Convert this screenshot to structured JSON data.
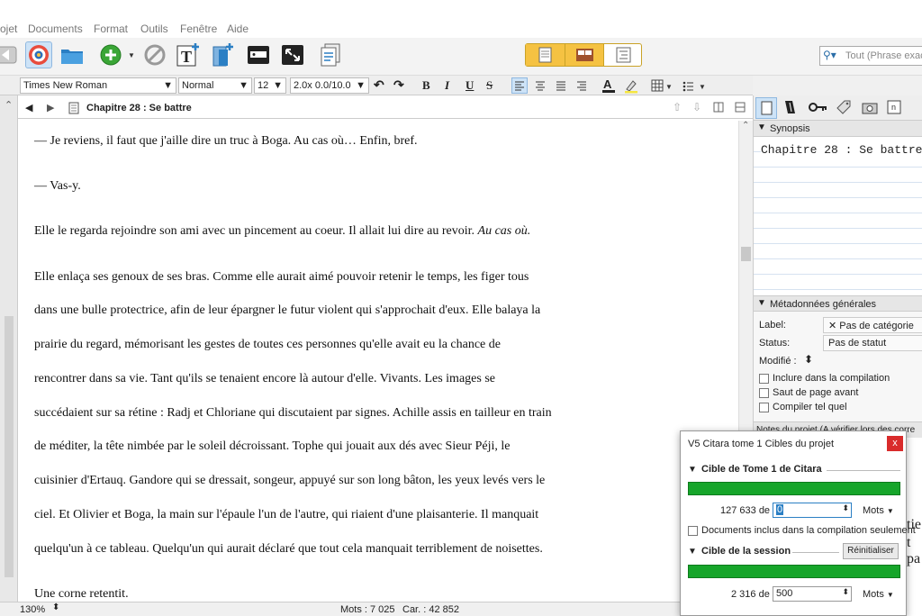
{
  "menu": [
    "ojet",
    "Documents",
    "Format",
    "Outils",
    "Fenêtre",
    "Aide"
  ],
  "search": {
    "placeholder": "Tout (Phrase exact"
  },
  "format": {
    "font": "Times New Roman",
    "style": "Normal",
    "size": "12",
    "spacing": "2.0x 0.0/10.0",
    "bold": "B",
    "italic": "I",
    "underline": "U",
    "strike": "S"
  },
  "editor": {
    "title": "Chapitre 28 : Se battre",
    "paragraphs": [
      "— Je reviens, il faut que j'aille dire un truc à Boga. Au cas où… Enfin, bref.",
      "— Vas-y.",
      "Elle le regarda rejoindre son ami avec un pincement au coeur. Il allait lui dire au revoir.",
      "Au cas où.",
      "Elle enlaça ses genoux de ses bras. Comme elle aurait aimé pouvoir retenir le temps, les figer tous",
      "dans une bulle protectrice, afin de leur épargner le futur violent qui s'approchait d'eux. Elle balaya la",
      "prairie du regard, mémorisant les gestes de toutes ces personnes qu'elle avait eu la chance de",
      "rencontrer dans sa vie. Tant qu'ils se tenaient encore là autour d'elle. Vivants. Les images se",
      "succédaient sur sa rétine :  Radj et Chloriane qui discutaient par signes. Achille assis en tailleur en train",
      "de méditer, la tête nimbée par le soleil décroissant. Tophe qui jouait aux dés avec Sieur Péji, le",
      "cuisinier d'Ertauq. Gandore qui se dressait, songeur, appuyé sur son long bâton, les yeux levés vers le",
      "ciel. Et Olivier et Boga, la main sur l'épaule l'un de l'autre, qui riaient d'une plaisanterie. Il manquait",
      "quelqu'un à ce tableau. Quelqu'un qui aurait déclaré que tout cela manquait terriblement de noisettes.",
      "Une corne retentit."
    ]
  },
  "status": {
    "zoom": "130%",
    "words": "Mots : 7 025",
    "chars": "Car. : 42 852"
  },
  "inspector": {
    "synopsis_header": "Synopsis",
    "synopsis_title": "Chapitre 28 : Se battre",
    "meta_header": "Métadonnées générales",
    "label_key": "Label:",
    "label_value": "Pas de catégorie",
    "status_key": "Status:",
    "status_value": "Pas de statut",
    "modified_key": "Modifié :",
    "include_compile": "Inclure dans la compilation",
    "page_break": "Saut de page avant",
    "compile_as_is": "Compiler tel quel",
    "notes": "Notes du projet (A vérifier lors des corre",
    "behind_text_1": "tie",
    "behind_text_2": "t pa"
  },
  "popup": {
    "title": "V5 Citara tome 1 Cibles du projet",
    "close": "x",
    "project_section": "Cible de Tome 1 de Citara",
    "project_count": "127 633 de",
    "project_target": "0",
    "project_unit": "Mots",
    "docs_included": "Documents inclus dans la compilation seulement",
    "session_section": "Cible de la session",
    "reset": "Réinitialiser",
    "session_count": "2 316 de",
    "session_target": "500",
    "session_unit": "Mots",
    "project_progress": 1.0,
    "session_progress": 1.0
  },
  "colors": {
    "accent": "#f5c242",
    "progress": "#16a52a",
    "close": "#d92b2b"
  }
}
